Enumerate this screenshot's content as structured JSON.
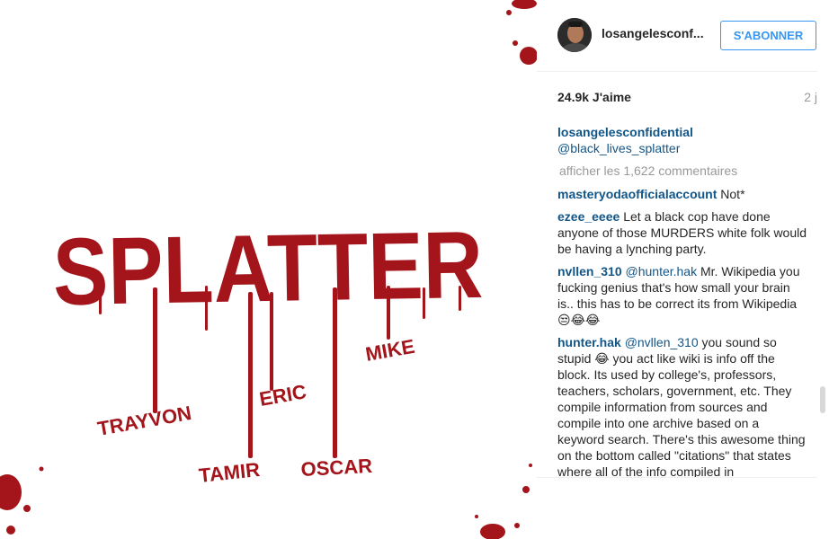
{
  "header": {
    "username": "losangelesconf...",
    "follow_label": "S'ABONNER"
  },
  "post": {
    "likes": "24.9k J'aime",
    "time": "2 j",
    "image_title": "SPLATTER",
    "image_names": [
      "TRAYVON",
      "TAMIR",
      "ERIC",
      "OSCAR",
      "MIKE"
    ],
    "splatter_color": "#a3151b"
  },
  "caption": {
    "author": "losangelesconfidential",
    "mention": "@black_lives_splatter"
  },
  "load_more": "afficher les 1,622 commentaires",
  "comments": [
    {
      "author": "masteryodaofficialaccount",
      "mention": "",
      "text": "Not*"
    },
    {
      "author": "ezee_eeee",
      "mention": "",
      "text": "Let a black cop have done anyone of those MURDERS white folk would be having a lynching party."
    },
    {
      "author": "nvllen_310",
      "mention": "@hunter.hak",
      "text": "Mr. Wikipedia you fucking genius that's how small your brain is.. this has to be correct its from Wikipedia 😒😂😂"
    },
    {
      "author": "hunter.hak",
      "mention": "@nvllen_310",
      "text": "you sound so stupid 😂 you act like wiki is info off the block. Its used by college's, professors, teachers, scholars, government, etc. They compile information from sources and compile into one archive based on a keyword search. There's this awesome thing on the bottom called \"citations\" that states where all of the info compiled in"
    }
  ]
}
